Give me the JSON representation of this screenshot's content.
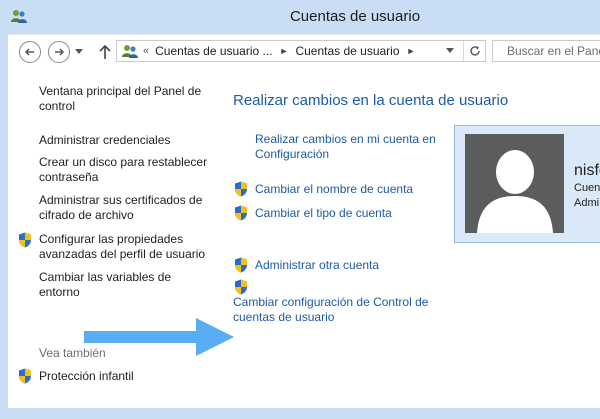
{
  "window": {
    "title": "Cuentas de usuario"
  },
  "navigation": {
    "breadcrumb": {
      "prefix": "«",
      "segments": [
        "Cuentas de usuario ...",
        "Cuentas de usuario"
      ]
    },
    "search_placeholder": "Buscar en el Panel de control"
  },
  "left_pane": {
    "links": [
      "Ventana principal del Panel de control",
      "Administrar credenciales",
      "Crear un disco para restablecer contraseña",
      "Administrar sus certificados de cifrado de archivo",
      "Configurar las propiedades avanzadas del perfil de usuario",
      "Cambiar las variables de entorno"
    ],
    "see_also_label": "Vea también",
    "see_also_links": [
      "Protección infantil"
    ]
  },
  "main": {
    "heading": "Realizar cambios en la cuenta de usuario",
    "tasks": [
      "Realizar cambios en mi cuenta en Configuración",
      "Cambiar el nombre de cuenta",
      "Cambiar el tipo de cuenta",
      "Administrar otra cuenta",
      "Cambiar configuración de Control de cuentas de usuario"
    ]
  },
  "account": {
    "name": "nisfe",
    "type_line1": "Cuen",
    "type_line2": "Admi"
  },
  "colors": {
    "link": "#1e5aa8",
    "frame": "#c9def4",
    "card": "#d9e9f8",
    "arrow": "#4aa6f2"
  }
}
